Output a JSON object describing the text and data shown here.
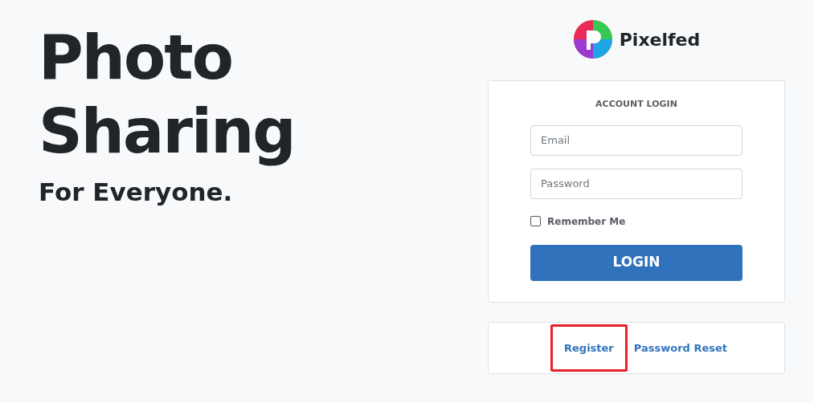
{
  "hero": {
    "title_lines": [
      "Photo",
      "Sharing"
    ],
    "subtitle": "For Everyone."
  },
  "brand": {
    "name": "Pixelfed"
  },
  "login": {
    "heading": "ACCOUNT LOGIN",
    "fields": [
      {
        "placeholder": "Email"
      },
      {
        "placeholder": "Password"
      }
    ],
    "remember": {
      "label": "Remember Me",
      "checked": false
    },
    "button": "LOGIN"
  },
  "links": [
    {
      "label": "Register",
      "highlighted": true
    },
    {
      "label": "Password Reset",
      "highlighted": false
    }
  ]
}
